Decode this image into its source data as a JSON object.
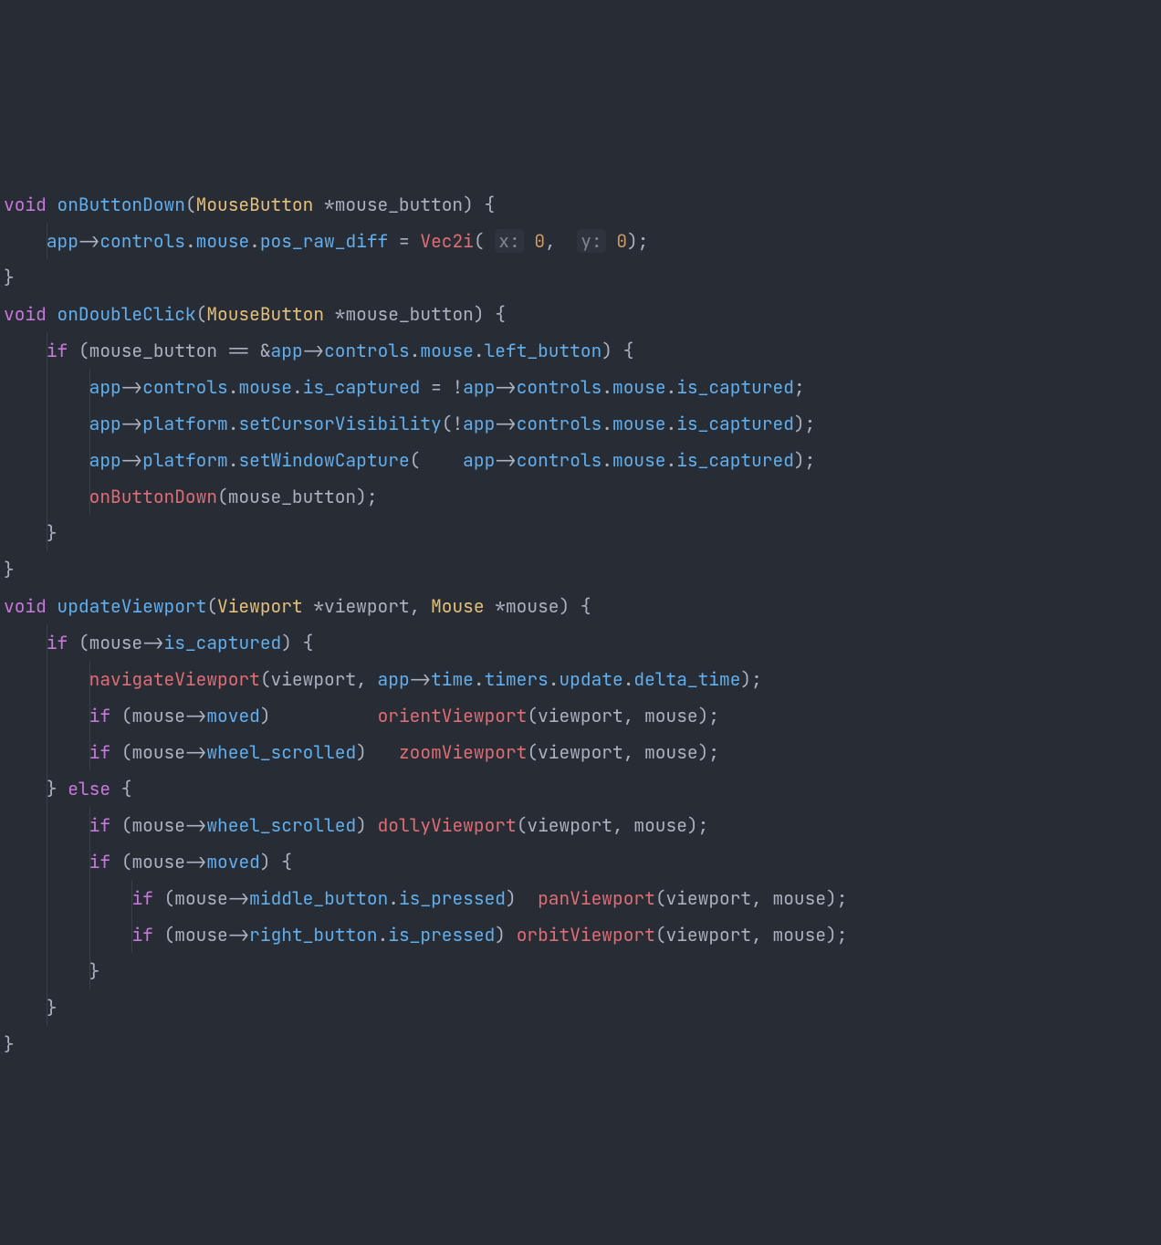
{
  "kw": {
    "void": "void",
    "if": "if",
    "else": "else"
  },
  "fn": {
    "onButtonDown": "onButtonDown",
    "onDoubleClick": "onDoubleClick",
    "updateViewport": "updateViewport",
    "app": "app",
    "controls": "controls",
    "mouse": "mouse",
    "pos_raw_diff": "pos_raw_diff",
    "left_button": "left_button",
    "is_captured": "is_captured",
    "platform": "platform",
    "setCursorVisibility": "setCursorVisibility",
    "setWindowCapture": "setWindowCapture",
    "moved": "moved",
    "wheel_scrolled": "wheel_scrolled",
    "middle_button": "middle_button",
    "right_button": "right_button",
    "is_pressed": "is_pressed",
    "time": "time",
    "timers": "timers",
    "update": "update",
    "delta_time": "delta_time"
  },
  "type": {
    "MouseButton": "MouseButton",
    "Viewport": "Viewport",
    "Mouse": "Mouse"
  },
  "call": {
    "Vec2i": "Vec2i",
    "navigateViewport": "navigateViewport",
    "orientViewport": "orientViewport",
    "zoomViewport": "zoomViewport",
    "dollyViewport": "dollyViewport",
    "panViewport": "panViewport",
    "orbitViewport": "orbitViewport",
    "onButtonDown_call": "onButtonDown"
  },
  "hint": {
    "x": "x:",
    "y": "y:"
  },
  "num": {
    "zero": "0"
  },
  "id": {
    "mouse_button": "mouse_button",
    "viewport": "viewport",
    "mouse": "mouse"
  }
}
